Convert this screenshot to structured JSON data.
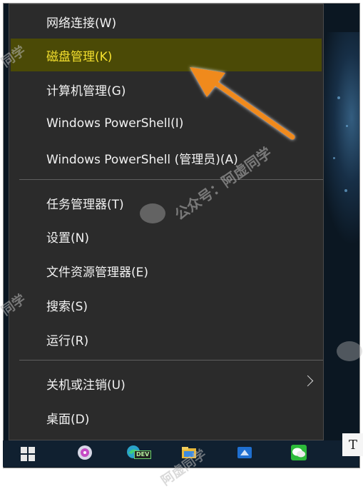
{
  "menu": {
    "items": [
      {
        "label": "网络连接(W)"
      },
      {
        "label": "磁盘管理(K)"
      },
      {
        "label": "计算机管理(G)"
      },
      {
        "label": "Windows PowerShell(I)"
      },
      {
        "label": "Windows PowerShell (管理员)(A)"
      },
      {
        "label": "任务管理器(T)"
      },
      {
        "label": "设置(N)"
      },
      {
        "label": "文件资源管理器(E)"
      },
      {
        "label": "搜索(S)"
      },
      {
        "label": "运行(R)"
      },
      {
        "label": "关机或注销(U)"
      },
      {
        "label": "桌面(D)"
      }
    ],
    "highlighted_item": "磁盘管理(K)",
    "highlight_color": "#4b4a06",
    "highlight_text_color": "#f4e02e"
  },
  "taskbar": {
    "dev_badge": "DEV",
    "text_tile": "T"
  },
  "watermark": {
    "text": "公众号：阿虚同学",
    "fragment": "同学",
    "fragment_2": "阿虚同学"
  },
  "annotation": {
    "arrow_color": "#f08a1c",
    "points_to": "磁盘管理(K)"
  }
}
